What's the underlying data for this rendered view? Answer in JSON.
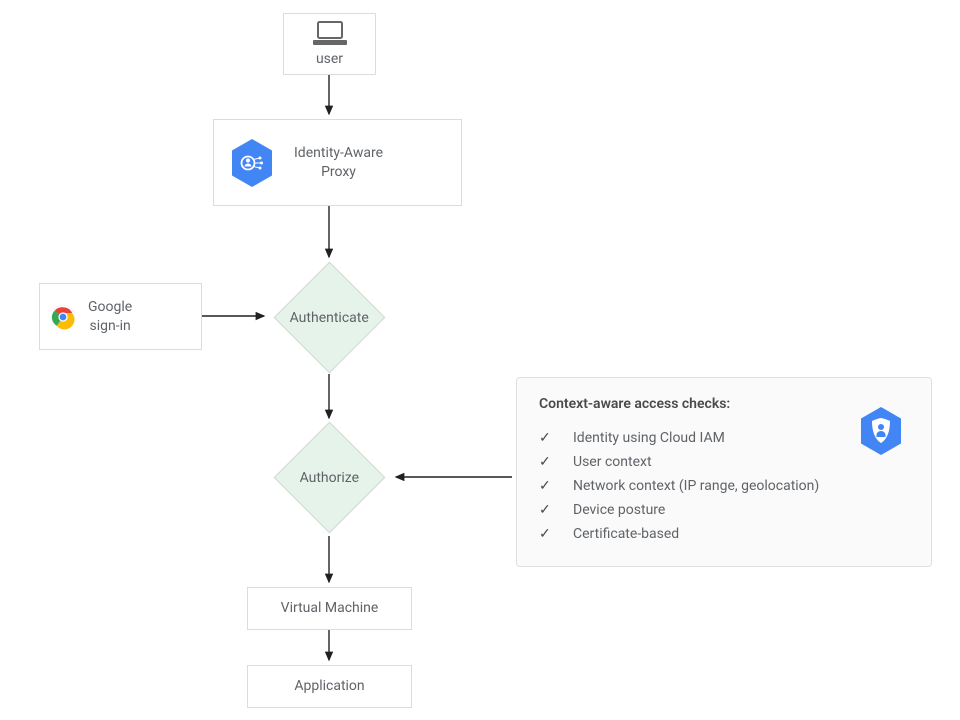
{
  "nodes": {
    "user": "user",
    "iap": "Identity-Aware\nProxy",
    "signin": "Google\nsign-in",
    "authenticate": "Authenticate",
    "authorize": "Authorize",
    "vm": "Virtual Machine",
    "app": "Application"
  },
  "info": {
    "title": "Context-aware access checks:",
    "items": [
      "Identity using Cloud IAM",
      "User context",
      "Network context (IP range, geolocation)",
      "Device posture",
      "Certificate-based"
    ]
  },
  "colors": {
    "hexagon": "#4285F4",
    "diamond_fill": "#e6f3ea"
  }
}
